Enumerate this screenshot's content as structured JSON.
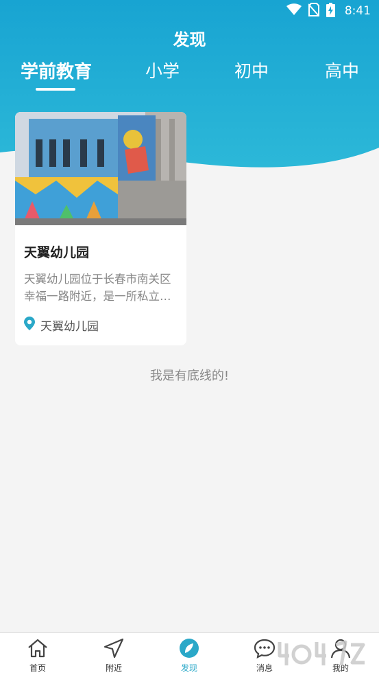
{
  "status_bar": {
    "time": "8:41"
  },
  "header": {
    "title": "发现"
  },
  "tabs": [
    {
      "label": "学前教育",
      "active": true
    },
    {
      "label": "小学",
      "active": false
    },
    {
      "label": "初中",
      "active": false
    },
    {
      "label": "高中",
      "active": false
    }
  ],
  "cards": [
    {
      "title": "天翼幼儿园",
      "description": "天翼幼儿园位于长春市南关区幸福一路附近，是一所私立…",
      "location": "天翼幼儿园"
    }
  ],
  "footer_note": "我是有底线的!",
  "bottom_nav": [
    {
      "label": "首页",
      "icon": "home-icon",
      "active": false
    },
    {
      "label": "附近",
      "icon": "navigation-arrow-icon",
      "active": false
    },
    {
      "label": "发现",
      "icon": "compass-icon",
      "active": true
    },
    {
      "label": "消息",
      "icon": "chat-bubble-icon",
      "active": false
    },
    {
      "label": "我的",
      "icon": "person-icon",
      "active": false
    }
  ],
  "colors": {
    "accent": "#2aa8c8",
    "header_top": "#1aa6d2",
    "header_bottom": "#28b6d6"
  }
}
